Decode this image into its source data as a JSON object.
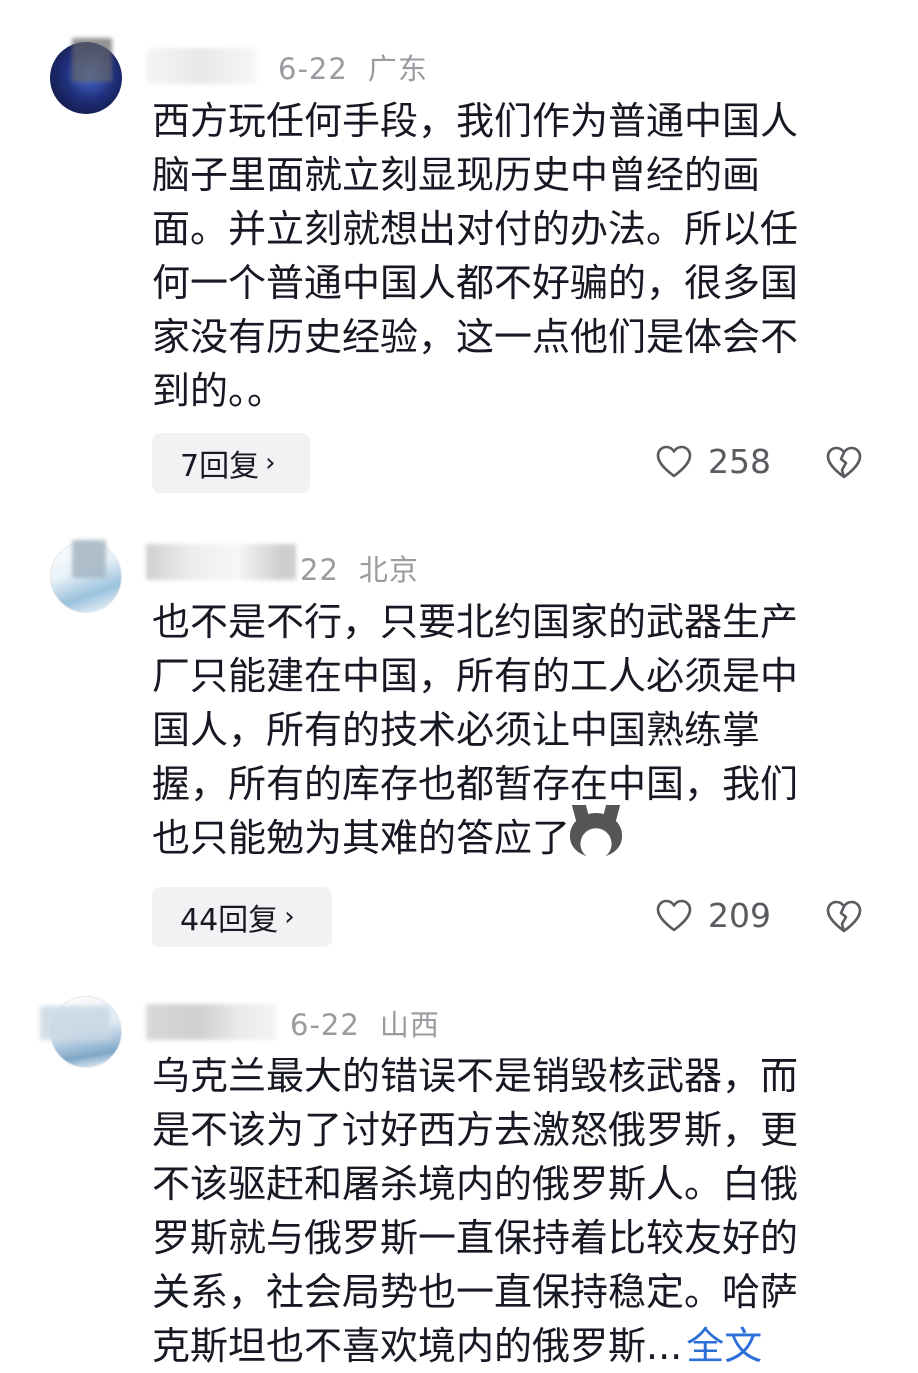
{
  "comments": [
    {
      "date": "6-22",
      "location": "广东",
      "lines": [
        "西方玩任何手段，我们作为普通中国人",
        "脑子里面就立刻显现历史中曾经的画",
        "面。并立刻就想出对付的办法。所以任",
        "何一个普通中国人都不好骗的，很多国",
        "家没有历史经验，这一点他们是体会不",
        "到的。。"
      ],
      "replies": "7回复",
      "likes": "258"
    },
    {
      "date": "22",
      "location": "北京",
      "lines": [
        "也不是不行，只要北约国家的武器生产",
        "厂只能建在中国，所有的工人必须是中",
        "国人，所有的技术必须让中国熟练掌",
        "握，所有的库存也都暂存在中国，我们",
        "也只能勉为其难的答应了"
      ],
      "emoji": "doge-emoji",
      "replies": "44回复",
      "likes": "209"
    },
    {
      "date": "6-22",
      "location": "山西",
      "lines": [
        "乌克兰最大的错误不是销毁核武器，而",
        "是不该为了讨好西方去激怒俄罗斯，更",
        "不该驱赶和屠杀境内的俄罗斯人。白俄",
        "罗斯就与俄罗斯一直保持着比较友好的",
        "关系，社会局势也一直保持稳定。哈萨",
        "克斯坦也不喜欢境内的俄罗斯..."
      ],
      "more": "全文"
    }
  ],
  "icons": {
    "reply_chevron": "›",
    "like": "heart-icon",
    "dislike": "broken-heart-icon"
  },
  "colors": {
    "text": "#161823",
    "meta": "#9a9aa0",
    "link": "#2d6fd8",
    "reply_bg": "#f2f2f4"
  }
}
